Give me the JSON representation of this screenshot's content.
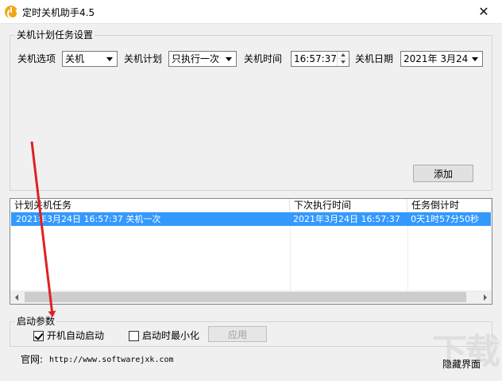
{
  "window": {
    "title": "定时关机助手4.5",
    "close_symbol": "✕"
  },
  "task_settings": {
    "group_title": "关机计划任务设置",
    "option_label": "关机选项",
    "option_value": "关机",
    "plan_label": "关机计划",
    "plan_value": "只执行一次",
    "time_label": "关机时间",
    "time_value": "16:57:37",
    "date_label": "关机日期",
    "date_value": "2021年  3月24日",
    "add_button": "添加"
  },
  "task_list": {
    "columns": [
      "计划关机任务",
      "下次执行时间",
      "任务倒计时"
    ],
    "rows": [
      [
        "2021年3月24日 16:57:37 关机一次",
        "2021年3月24日 16:57:37",
        "0天1时57分50秒"
      ]
    ]
  },
  "startup": {
    "group_title": "启动参数",
    "auto_start_label": "开机自动启动",
    "auto_start_checked": true,
    "minimize_label": "启动时最小化",
    "minimize_checked": false,
    "apply_button": "应用"
  },
  "footer": {
    "website_label": "官网:",
    "website_url": "http://www.softwarejxk.com",
    "hide_button": "隐藏界面"
  },
  "colors": {
    "selection": "#3399ff",
    "annotation_arrow": "#e02020"
  }
}
